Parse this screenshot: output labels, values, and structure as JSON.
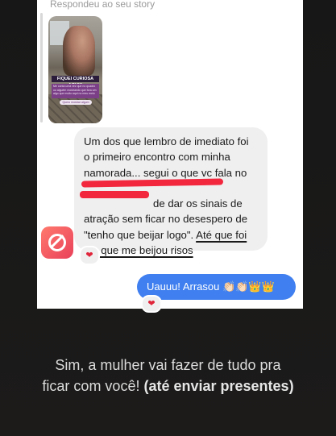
{
  "story_reply": {
    "label": "Respondeu ao seu story",
    "story_tag": "FIQUEI CURIOSA AQUI!!",
    "story_caption": "Me conta uma vez que no quadro ou alguém mostrando que fora um algo que muito aqui no meu meio",
    "story_button": "Quero mostrar algum"
  },
  "incoming_message": {
    "line1": "Um dos que lembro de imediato foi",
    "line2": "o primeiro encontro com minha",
    "line3": "namorada... segui o que vc fala no",
    "line4_visible": "de dar os sinais de",
    "line5": "atração sem ficar no desespero de",
    "line6": "\"tenho que beijar logo\".",
    "underlined_1": "Até que foi",
    "underlined_2": "ela que me beijou risos",
    "reaction": "❤"
  },
  "outgoing_message": {
    "text": "Uauuu! Arrasou 👏🏻👏🏻👑👑",
    "reaction": "❤"
  },
  "caption": {
    "line1": "Sim, a mulher vai fazer de tudo pra",
    "line2_plain": "ficar com você!",
    "line2_bold": "(até enviar presentes)"
  },
  "colors": {
    "background": "#1b1a19",
    "incoming_bubble": "#efefef",
    "outgoing_bubble": "#3f7fef",
    "redaction": "#f2263d",
    "heart": "#e0243a",
    "avatar_gradient_start": "#ff7a6e",
    "avatar_gradient_end": "#e9415a"
  }
}
